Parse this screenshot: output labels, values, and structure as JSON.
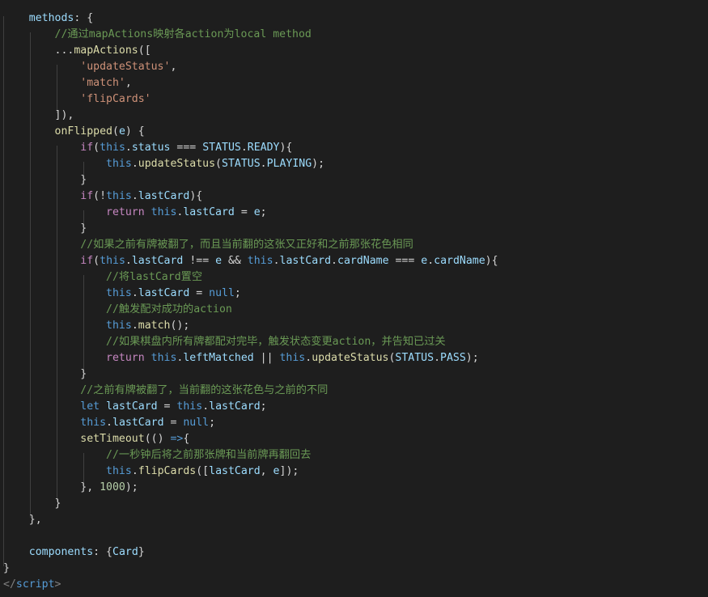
{
  "editor": {
    "language": "javascript",
    "colors": {
      "background": "#1e1e1e",
      "default": "#d4d4d4",
      "property": "#9cdcfe",
      "keyword": "#569cd6",
      "control": "#c586c0",
      "function": "#dcdcaa",
      "string": "#ce9178",
      "comment": "#6a9955",
      "number": "#b5cea8",
      "indent_guide": "#404040"
    },
    "lines": [
      [
        [
          "    ",
          "default"
        ],
        [
          "methods",
          "property"
        ],
        [
          ": {",
          "default"
        ]
      ],
      [
        [
          "        ",
          "default"
        ],
        [
          "//通过mapActions映射各action为local method",
          "comment"
        ]
      ],
      [
        [
          "        ...",
          "default"
        ],
        [
          "mapActions",
          "function"
        ],
        [
          "([",
          "default"
        ]
      ],
      [
        [
          "            ",
          "default"
        ],
        [
          "'updateStatus'",
          "string"
        ],
        [
          ",",
          "default"
        ]
      ],
      [
        [
          "            ",
          "default"
        ],
        [
          "'match'",
          "string"
        ],
        [
          ",",
          "default"
        ]
      ],
      [
        [
          "            ",
          "default"
        ],
        [
          "'flipCards'",
          "string"
        ]
      ],
      [
        [
          "        ]),",
          "default"
        ]
      ],
      [
        [
          "        ",
          "default"
        ],
        [
          "onFlipped",
          "function"
        ],
        [
          "(",
          "default"
        ],
        [
          "e",
          "property"
        ],
        [
          ") {",
          "default"
        ]
      ],
      [
        [
          "            ",
          "default"
        ],
        [
          "if",
          "control"
        ],
        [
          "(",
          "default"
        ],
        [
          "this",
          "keyword"
        ],
        [
          ".",
          "default"
        ],
        [
          "status",
          "property"
        ],
        [
          " === ",
          "default"
        ],
        [
          "STATUS",
          "property"
        ],
        [
          ".",
          "default"
        ],
        [
          "READY",
          "property"
        ],
        [
          "){",
          "default"
        ]
      ],
      [
        [
          "                ",
          "default"
        ],
        [
          "this",
          "keyword"
        ],
        [
          ".",
          "default"
        ],
        [
          "updateStatus",
          "function"
        ],
        [
          "(",
          "default"
        ],
        [
          "STATUS",
          "property"
        ],
        [
          ".",
          "default"
        ],
        [
          "PLAYING",
          "property"
        ],
        [
          ");",
          "default"
        ]
      ],
      [
        [
          "            }",
          "default"
        ]
      ],
      [
        [
          "            ",
          "default"
        ],
        [
          "if",
          "control"
        ],
        [
          "(!",
          "default"
        ],
        [
          "this",
          "keyword"
        ],
        [
          ".",
          "default"
        ],
        [
          "lastCard",
          "property"
        ],
        [
          "){",
          "default"
        ]
      ],
      [
        [
          "                ",
          "default"
        ],
        [
          "return",
          "control"
        ],
        [
          " ",
          "default"
        ],
        [
          "this",
          "keyword"
        ],
        [
          ".",
          "default"
        ],
        [
          "lastCard",
          "property"
        ],
        [
          " = ",
          "default"
        ],
        [
          "e",
          "property"
        ],
        [
          ";",
          "default"
        ]
      ],
      [
        [
          "            }",
          "default"
        ]
      ],
      [
        [
          "            ",
          "default"
        ],
        [
          "//如果之前有牌被翻了，而且当前翻的这张又正好和之前那张花色相同",
          "comment"
        ]
      ],
      [
        [
          "            ",
          "default"
        ],
        [
          "if",
          "control"
        ],
        [
          "(",
          "default"
        ],
        [
          "this",
          "keyword"
        ],
        [
          ".",
          "default"
        ],
        [
          "lastCard",
          "property"
        ],
        [
          " !== ",
          "default"
        ],
        [
          "e",
          "property"
        ],
        [
          " && ",
          "default"
        ],
        [
          "this",
          "keyword"
        ],
        [
          ".",
          "default"
        ],
        [
          "lastCard",
          "property"
        ],
        [
          ".",
          "default"
        ],
        [
          "cardName",
          "property"
        ],
        [
          " === ",
          "default"
        ],
        [
          "e",
          "property"
        ],
        [
          ".",
          "default"
        ],
        [
          "cardName",
          "property"
        ],
        [
          "){",
          "default"
        ]
      ],
      [
        [
          "                ",
          "default"
        ],
        [
          "//将lastCard置空",
          "comment"
        ]
      ],
      [
        [
          "                ",
          "default"
        ],
        [
          "this",
          "keyword"
        ],
        [
          ".",
          "default"
        ],
        [
          "lastCard",
          "property"
        ],
        [
          " = ",
          "default"
        ],
        [
          "null",
          "keyword"
        ],
        [
          ";",
          "default"
        ]
      ],
      [
        [
          "                ",
          "default"
        ],
        [
          "//触发配对成功的action",
          "comment"
        ]
      ],
      [
        [
          "                ",
          "default"
        ],
        [
          "this",
          "keyword"
        ],
        [
          ".",
          "default"
        ],
        [
          "match",
          "function"
        ],
        [
          "();",
          "default"
        ]
      ],
      [
        [
          "                ",
          "default"
        ],
        [
          "//如果棋盘内所有牌都配对完毕，触发状态变更action，并告知已过关",
          "comment"
        ]
      ],
      [
        [
          "                ",
          "default"
        ],
        [
          "return",
          "control"
        ],
        [
          " ",
          "default"
        ],
        [
          "this",
          "keyword"
        ],
        [
          ".",
          "default"
        ],
        [
          "leftMatched",
          "property"
        ],
        [
          " || ",
          "default"
        ],
        [
          "this",
          "keyword"
        ],
        [
          ".",
          "default"
        ],
        [
          "updateStatus",
          "function"
        ],
        [
          "(",
          "default"
        ],
        [
          "STATUS",
          "property"
        ],
        [
          ".",
          "default"
        ],
        [
          "PASS",
          "property"
        ],
        [
          ");",
          "default"
        ]
      ],
      [
        [
          "            }",
          "default"
        ]
      ],
      [
        [
          "            ",
          "default"
        ],
        [
          "//之前有牌被翻了，当前翻的这张花色与之前的不同",
          "comment"
        ]
      ],
      [
        [
          "            ",
          "default"
        ],
        [
          "let",
          "keyword"
        ],
        [
          " ",
          "default"
        ],
        [
          "lastCard",
          "property"
        ],
        [
          " = ",
          "default"
        ],
        [
          "this",
          "keyword"
        ],
        [
          ".",
          "default"
        ],
        [
          "lastCard",
          "property"
        ],
        [
          ";",
          "default"
        ]
      ],
      [
        [
          "            ",
          "default"
        ],
        [
          "this",
          "keyword"
        ],
        [
          ".",
          "default"
        ],
        [
          "lastCard",
          "property"
        ],
        [
          " = ",
          "default"
        ],
        [
          "null",
          "keyword"
        ],
        [
          ";",
          "default"
        ]
      ],
      [
        [
          "            ",
          "default"
        ],
        [
          "setTimeout",
          "function"
        ],
        [
          "(() ",
          "default"
        ],
        [
          "=>",
          "keyword"
        ],
        [
          "{",
          "default"
        ]
      ],
      [
        [
          "                ",
          "default"
        ],
        [
          "//一秒钟后将之前那张牌和当前牌再翻回去",
          "comment"
        ]
      ],
      [
        [
          "                ",
          "default"
        ],
        [
          "this",
          "keyword"
        ],
        [
          ".",
          "default"
        ],
        [
          "flipCards",
          "function"
        ],
        [
          "([",
          "default"
        ],
        [
          "lastCard",
          "property"
        ],
        [
          ", ",
          "default"
        ],
        [
          "e",
          "property"
        ],
        [
          "]);",
          "default"
        ]
      ],
      [
        [
          "            }, ",
          "default"
        ],
        [
          "1000",
          "number"
        ],
        [
          ");",
          "default"
        ]
      ],
      [
        [
          "        }",
          "default"
        ]
      ],
      [
        [
          "    },",
          "default"
        ]
      ],
      [
        [
          "",
          "default"
        ]
      ],
      [
        [
          "    ",
          "default"
        ],
        [
          "components",
          "property"
        ],
        [
          ": {",
          "default"
        ],
        [
          "Card",
          "property"
        ],
        [
          "}",
          "default"
        ]
      ],
      [
        [
          "}",
          "default"
        ]
      ],
      [
        [
          "</",
          "tagpunct"
        ],
        [
          "script",
          "tag"
        ],
        [
          ">",
          "tagpunct"
        ]
      ]
    ]
  }
}
